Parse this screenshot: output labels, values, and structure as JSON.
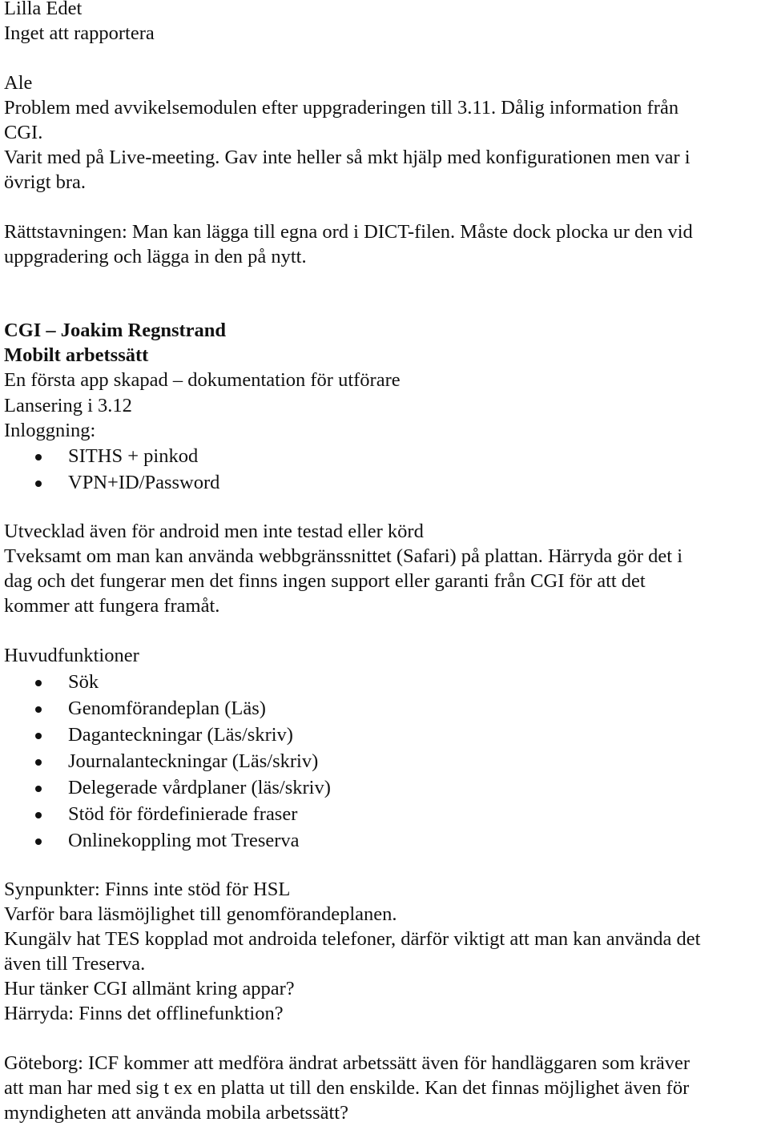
{
  "sections": {
    "lilla_edet": {
      "heading": "Lilla Edet",
      "text": "Inget att rapportera"
    },
    "ale": {
      "heading": "Ale",
      "lines": [
        "Problem med avvikelsemodulen efter uppgraderingen till 3.11. Dålig information från",
        "CGI.",
        "Varit med på Live-meeting. Gav inte heller så mkt hjälp med konfigurationen men var i",
        "övrigt bra."
      ],
      "spelling_lines": [
        "Rättstavningen: Man kan lägga till egna ord i DICT-filen. Måste dock plocka ur den vid",
        "uppgradering och lägga in den på nytt."
      ]
    },
    "cgi": {
      "heading": "CGI – Joakim Regnstrand",
      "subheading": "Mobilt arbetssätt",
      "intro": "En första app skapad – dokumentation för utförare",
      "launch": "Lansering i 3.12",
      "login_label": "Inloggning:",
      "login_items": [
        "SITHS + pinkod",
        "VPN+ID/Password"
      ],
      "android_line": "Utvecklad även för android men inte testad eller körd",
      "safari_lines": [
        "Tveksamt om man kan använda webbgränssnittet (Safari) på plattan. Härryda gör det i",
        "dag och det fungerar men det finns ingen support eller garanti från CGI för att det",
        "kommer att fungera framåt."
      ],
      "functions_label": "Huvudfunktioner",
      "functions": [
        "Sök",
        "Genomförandeplan (Läs)",
        "Daganteckningar (Läs/skriv)",
        "Journalanteckningar (Läs/skriv)",
        "Delegerade vårdplaner (läs/skriv)",
        "Stöd för fördefinierade fraser",
        "Onlinekoppling mot Treserva"
      ],
      "feedback_lines": [
        "Synpunkter: Finns inte stöd för HSL",
        "Varför bara läsmöjlighet till genomförandeplanen.",
        "Kungälv hat TES kopplad mot androida telefoner, därför viktigt att man kan använda det",
        "även till Treserva.",
        "Hur tänker CGI allmänt kring appar?",
        "Härryda: Finns det offlinefunktion?"
      ]
    },
    "goteborg": {
      "lines": [
        "Göteborg: ICF kommer att medföra ändrat arbetssätt även för handläggaren som kräver",
        "att man har med sig t ex en platta ut till den enskilde. Kan det finnas möjlighet även för",
        "myndigheten att använda mobila arbetssätt?"
      ]
    }
  }
}
